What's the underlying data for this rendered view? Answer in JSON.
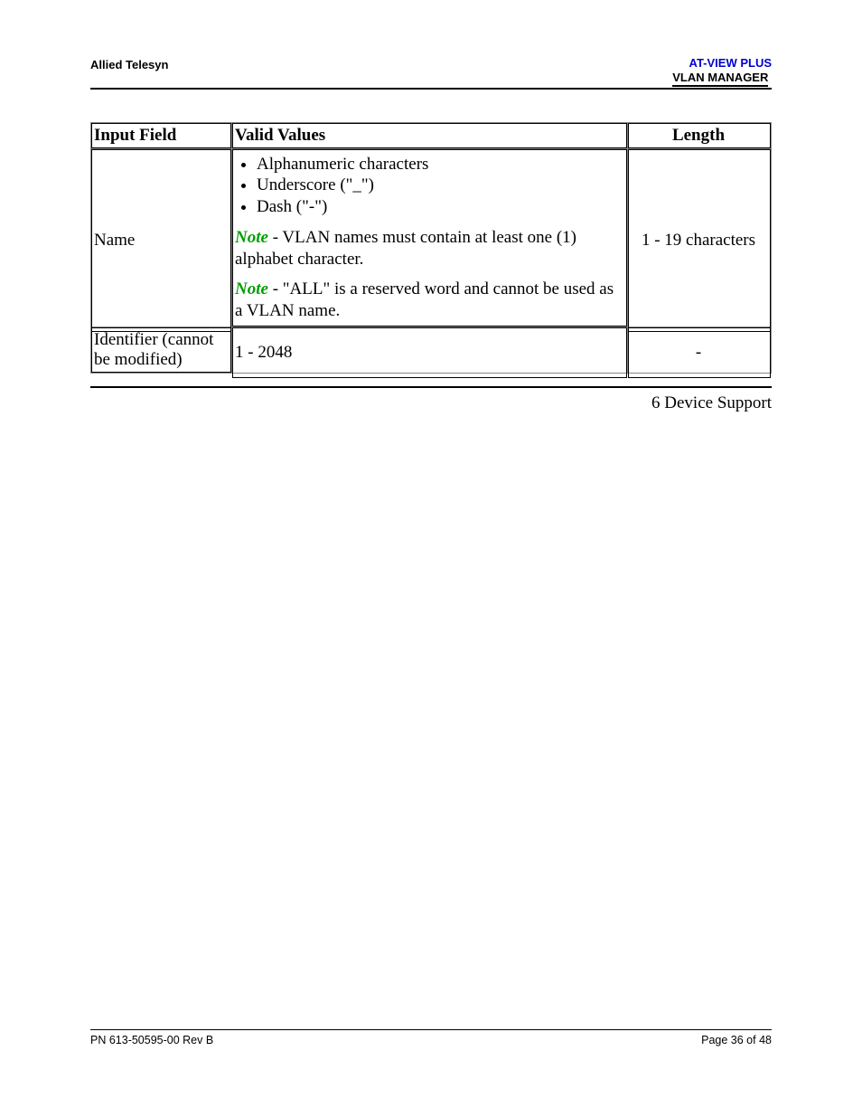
{
  "header": {
    "left": "Allied Telesyn",
    "right_line1": "AT-VIEW PLUS",
    "right_line2": "VLAN MANAGER"
  },
  "table": {
    "headers": {
      "input_field": "Input Field",
      "valid_values": "Valid Values",
      "length": "Length"
    },
    "rows": [
      {
        "input_field": "Name",
        "valid_values": {
          "bullets": [
            "Alphanumeric characters",
            "Underscore (\"_\")",
            "Dash (\"-\")"
          ],
          "note_label": "Note",
          "note1_text": " - VLAN names must contain at least one (1) alphabet character.",
          "note2_text": " - \"ALL\" is a reserved word and cannot be used as a VLAN name."
        },
        "length": "1 - 19 characters"
      },
      {
        "input_field": "Identifier (cannot be modified)",
        "valid_values_text": "1 - 2048",
        "length": "-"
      }
    ]
  },
  "section_title": "6 Device Support",
  "footer": {
    "left": "PN 613-50595-00 Rev B",
    "right": "Page 36 of 48"
  }
}
